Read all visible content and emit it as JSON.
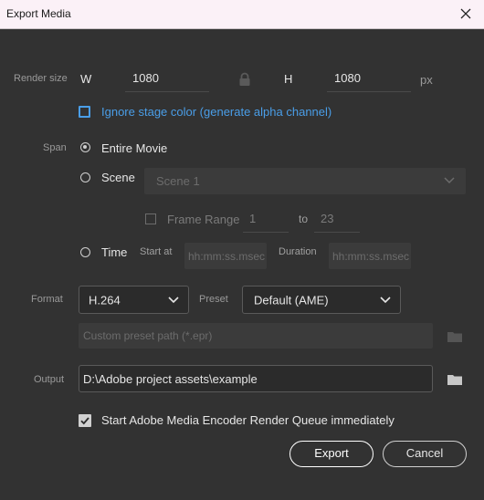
{
  "window": {
    "title": "Export Media"
  },
  "render_size": {
    "label": "Render size",
    "w_label": "W",
    "w_value": "1080",
    "h_label": "H",
    "h_value": "1080",
    "unit": "px"
  },
  "ignore_stage": {
    "label": "Ignore stage color (generate alpha channel)",
    "checked": false
  },
  "span": {
    "label": "Span",
    "entire_movie": "Entire Movie",
    "scene": "Scene",
    "scene_value": "Scene 1",
    "frame_range_label": "Frame Range",
    "frame_from": "1",
    "frame_to_label": "to",
    "frame_to": "23",
    "time": "Time",
    "start_at_label": "Start at",
    "start_placeholder": "hh:mm:ss.msec",
    "duration_label": "Duration",
    "duration_placeholder": "hh:mm:ss.msec",
    "selected": "Entire Movie"
  },
  "format": {
    "label": "Format",
    "value": "H.264",
    "preset_label": "Preset",
    "preset_value": "Default (AME)",
    "custom_preset_placeholder": "Custom preset path (*.epr)"
  },
  "output": {
    "label": "Output",
    "value": "D:\\Adobe project assets\\example"
  },
  "ame_queue": {
    "label": "Start Adobe Media Encoder Render Queue immediately",
    "checked": true
  },
  "buttons": {
    "export": "Export",
    "cancel": "Cancel"
  },
  "colors": {
    "accent": "#4a9ee8",
    "background": "#323232"
  }
}
